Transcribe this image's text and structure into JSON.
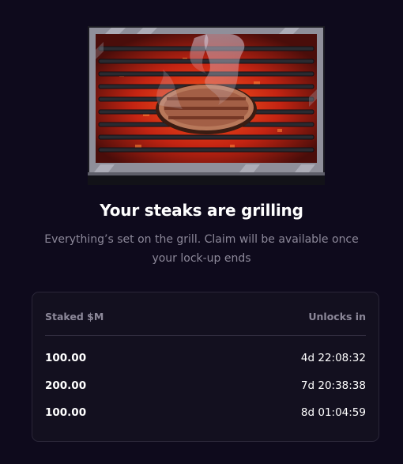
{
  "illustration": {
    "icon": "grill-steak-icon"
  },
  "heading": {
    "title": "Your steaks are grilling"
  },
  "subtitle": {
    "text": "Everything’s set on the grill. Claim will be available once your lock-up ends"
  },
  "stakes_table": {
    "headers": {
      "staked": "Staked $M",
      "unlocks": "Unlocks in"
    },
    "rows": [
      {
        "amount": "100.00",
        "unlocks_in": "4d 22:08:32"
      },
      {
        "amount": "200.00",
        "unlocks_in": "7d 20:38:38"
      },
      {
        "amount": "100.00",
        "unlocks_in": "8d 01:04:59"
      }
    ]
  },
  "colors": {
    "background": "#0e0a1c",
    "muted_text": "#8c8899",
    "card_border": "#2a2638"
  }
}
